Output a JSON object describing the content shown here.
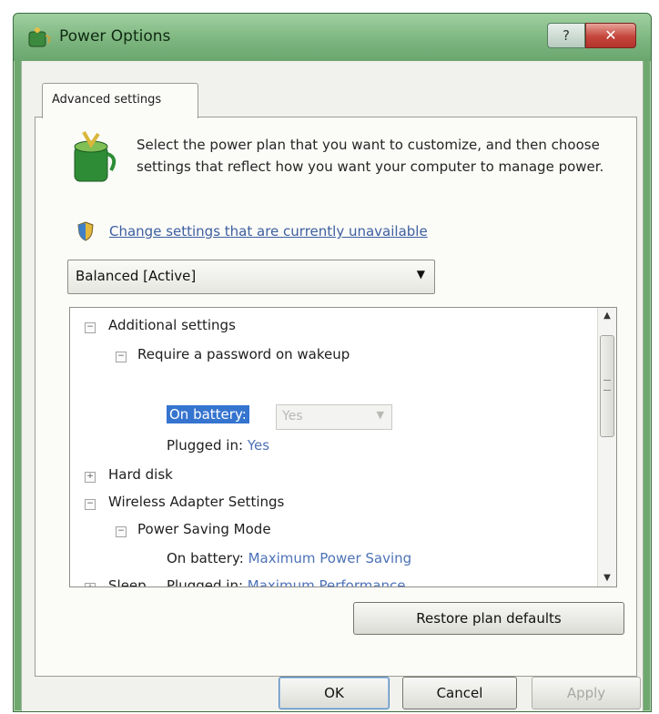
{
  "window": {
    "title": "Power Options"
  },
  "titlebar_buttons": {
    "help": "?",
    "close": "✕"
  },
  "tabs": [
    {
      "label": "Advanced settings"
    }
  ],
  "intro": {
    "text": "Select the power plan that you want to customize, and then choose settings that reflect how you want your computer to manage power.",
    "link": "Change settings that are currently unavailable"
  },
  "plan_select": {
    "value": "Balanced [Active]"
  },
  "tree": {
    "additional_settings": "Additional settings",
    "require_password": "Require a password on wakeup",
    "on_battery_label": "On battery:",
    "on_battery_value": "Yes",
    "plugged_in_label": "Plugged in:",
    "plugged_in_value": "Yes",
    "hard_disk": "Hard disk",
    "wireless": "Wireless Adapter Settings",
    "power_saving": "Power Saving Mode",
    "ps_on_battery_label": "On battery:",
    "ps_on_battery_value": "Maximum Power Saving",
    "ps_plugged_in_label": "Plugged in:",
    "ps_plugged_in_value": "Maximum Performance",
    "sleep": "Sleep"
  },
  "buttons": {
    "restore": "Restore plan defaults",
    "ok": "OK",
    "cancel": "Cancel",
    "apply": "Apply"
  },
  "colors": {
    "titlebar": "#7bb47d",
    "link": "#3d5fa0",
    "selection": "#3574cf",
    "close": "#c4453b"
  }
}
